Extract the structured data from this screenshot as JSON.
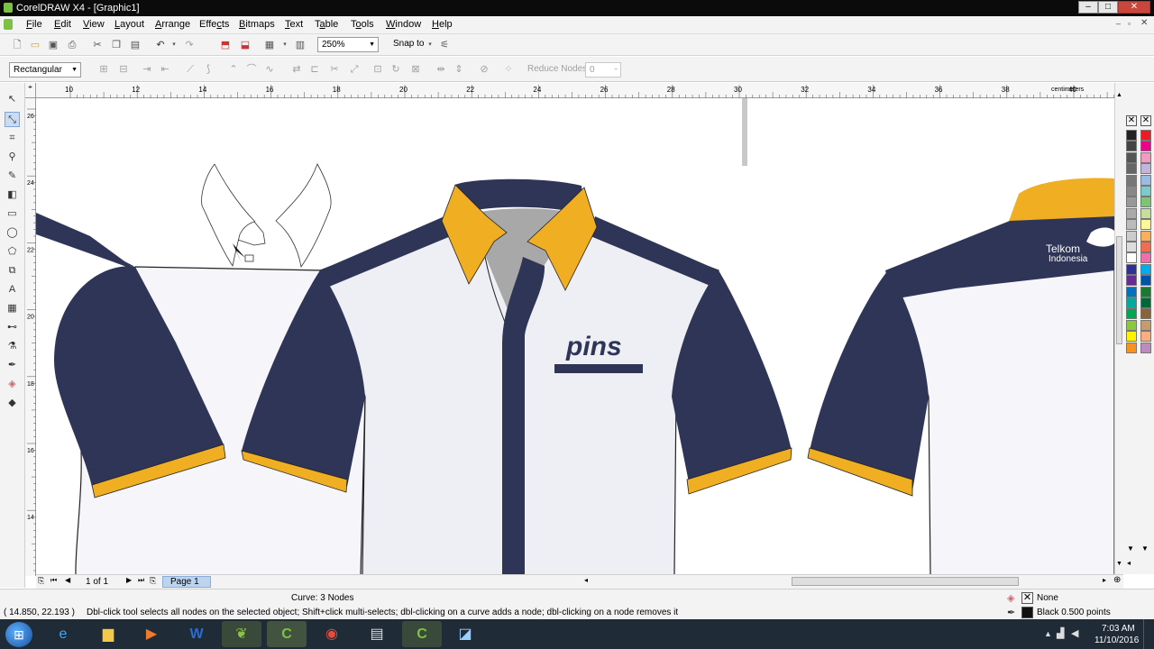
{
  "window": {
    "title": "CorelDRAW X4 - [Graphic1]"
  },
  "menu": [
    {
      "pre": "",
      "u": "F",
      "post": "ile"
    },
    {
      "pre": "",
      "u": "E",
      "post": "dit"
    },
    {
      "pre": "",
      "u": "V",
      "post": "iew"
    },
    {
      "pre": "",
      "u": "L",
      "post": "ayout"
    },
    {
      "pre": "",
      "u": "A",
      "post": "rrange"
    },
    {
      "pre": "Effe",
      "u": "c",
      "post": "ts"
    },
    {
      "pre": "",
      "u": "B",
      "post": "itmaps"
    },
    {
      "pre": "",
      "u": "T",
      "post": "ext"
    },
    {
      "pre": "T",
      "u": "a",
      "post": "ble"
    },
    {
      "pre": "T",
      "u": "o",
      "post": "ols"
    },
    {
      "pre": "",
      "u": "W",
      "post": "indow"
    },
    {
      "pre": "",
      "u": "H",
      "post": "elp"
    }
  ],
  "toolbar": {
    "zoom": "250%",
    "snap_to": "Snap to"
  },
  "property_bar": {
    "selection_mode": "Rectangular",
    "reduce_nodes_label": "Reduce Nodes",
    "reduce_nodes_value": "0"
  },
  "ruler": {
    "unit": "centimeters",
    "top_ticks": [
      "10",
      "12",
      "14",
      "16",
      "18",
      "20",
      "22",
      "24",
      "26",
      "28",
      "30",
      "32",
      "34",
      "36",
      "38",
      "40"
    ],
    "left_ticks": [
      "26",
      "24",
      "22",
      "20",
      "18",
      "16",
      "14"
    ]
  },
  "artwork": {
    "logo_text": "pins",
    "brand_line1": "Telkom",
    "brand_line2": "Indonesia",
    "colors": {
      "navy": "#2e3557",
      "gold": "#f0ae22",
      "body": "#eeeef5",
      "collar_inner": "#a8a8a8"
    }
  },
  "page_nav": {
    "page_count": "1 of 1",
    "page_tab": "Page 1"
  },
  "status": {
    "object_info": "Curve: 3 Nodes",
    "coordinates": "( 14.850, 22.193 )",
    "hint": "Dbl-click tool selects all nodes on the selected object; Shift+click multi-selects; dbl-clicking on a curve adds a node; dbl-clicking on a node removes it",
    "fill_label": "None",
    "outline_label": "Black  0.500 points"
  },
  "palette_colors": [
    "#222222",
    "#444444",
    "#555555",
    "#666666",
    "#777777",
    "#888888",
    "#999999",
    "#aaaaaa",
    "#bbbbbb",
    "#cccccc",
    "#dddddd",
    "#ffffff",
    "#2e3192",
    "#662d91",
    "#0072bc",
    "#00a99d",
    "#00a651",
    "#8dc63f",
    "#fff200",
    "#f7941d",
    "#ed1c24",
    "#ec008c",
    "#f49ac1",
    "#c2b5d9",
    "#9bbbe0",
    "#7accc8",
    "#7cc576",
    "#c4df9b",
    "#fff799",
    "#fbaf5d",
    "#f26c4f",
    "#f06eaa",
    "#00aeef",
    "#0054a6",
    "#197b30",
    "#006837",
    "#8c6239",
    "#c69c6d",
    "#f9ad81",
    "#bd8cbf"
  ],
  "taskbar": {
    "time": "7:03 AM",
    "date": "11/10/2016"
  }
}
